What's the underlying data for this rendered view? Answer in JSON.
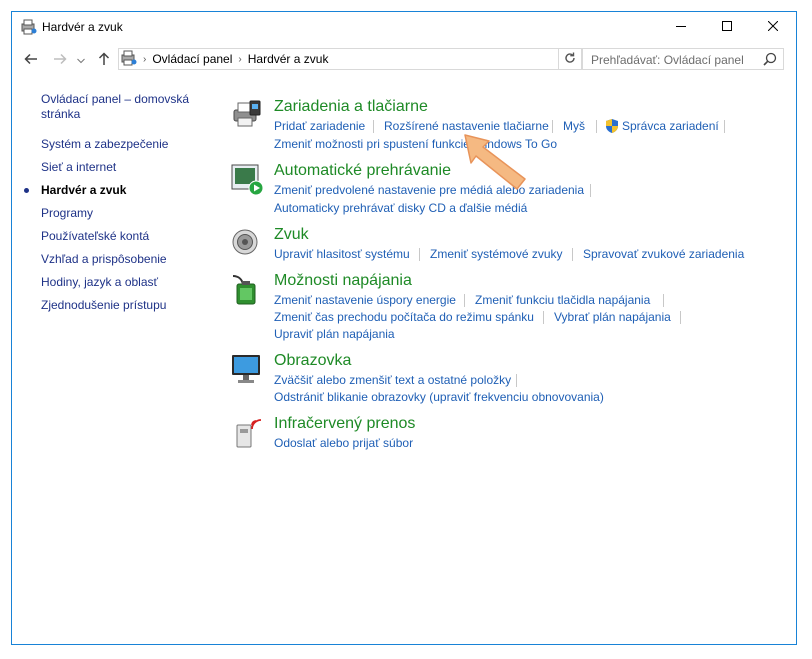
{
  "window": {
    "title": "Hardvér a zvuk",
    "controls": [
      "minimize-icon",
      "maximize-icon",
      "close-icon"
    ]
  },
  "navigation": {
    "breadcrumbs": [
      "Ovládací panel",
      "Hardvér a zvuk"
    ],
    "search_placeholder": "Prehľadávať: Ovládací panel"
  },
  "sidebar": {
    "items": [
      {
        "label": "Ovládací panel – domovská stránka",
        "lines": [
          "Ovládací panel – domovská",
          "stránka"
        ]
      },
      {
        "label": "Systém a zabezpečenie"
      },
      {
        "label": "Sieť a internet"
      },
      {
        "label": "Hardvér a zvuk",
        "active": true
      },
      {
        "label": "Programy"
      },
      {
        "label": "Používateľské kontá"
      },
      {
        "label": "Vzhľad a prispôsobenie"
      },
      {
        "label": "Hodiny, jazyk a oblasť"
      },
      {
        "label": "Zjednodušenie prístupu"
      }
    ]
  },
  "categories": [
    {
      "title": "Zariadenia a tlačiarne",
      "icon": "printer-icon",
      "links": [
        [
          "Pridať zariadenie",
          "Rozšírené nastavenie tlačiarne",
          "Myš",
          "Správca zariadení"
        ],
        [
          "Zmeniť možnosti pri spustení funkcie Windows To Go"
        ]
      ]
    },
    {
      "title": "Automatické prehrávanie",
      "icon": "autoplay-icon",
      "links": [
        [
          "Zmeniť predvolené nastavenie pre médiá alebo zariadenia"
        ],
        [
          "Automaticky prehrávať disky CD a ďalšie médiá"
        ]
      ]
    },
    {
      "title": "Zvuk",
      "icon": "speaker-icon",
      "links": [
        [
          "Upraviť hlasitosť systému",
          "Zmeniť systémové zvuky",
          "Spravovať zvukové zariadenia"
        ]
      ]
    },
    {
      "title": "Možnosti napájania",
      "icon": "battery-icon",
      "links": [
        [
          "Zmeniť nastavenie úspory energie",
          "Zmeniť funkciu tlačidla napájania"
        ],
        [
          "Zmeniť čas prechodu počítača do režimu spánku",
          "Vybrať plán napájania"
        ],
        [
          "Upraviť plán napájania"
        ]
      ]
    },
    {
      "title": "Obrazovka",
      "icon": "monitor-icon",
      "links": [
        [
          "Zväčšiť alebo zmenšiť text a ostatné položky"
        ],
        [
          "Odstrániť blikanie obrazovky (upraviť frekvenciu obnovovania)"
        ]
      ]
    },
    {
      "title": "Infračervený prenos",
      "icon": "infrared-icon",
      "links": [
        [
          "Odoslať alebo prijať súbor"
        ]
      ]
    }
  ],
  "colors": {
    "accent_border": "#1883d7",
    "category_title": "#1e8a26",
    "link": "#1f5fb5",
    "nav_link": "#1e3287",
    "pointer_arrow": "#f5b982"
  }
}
